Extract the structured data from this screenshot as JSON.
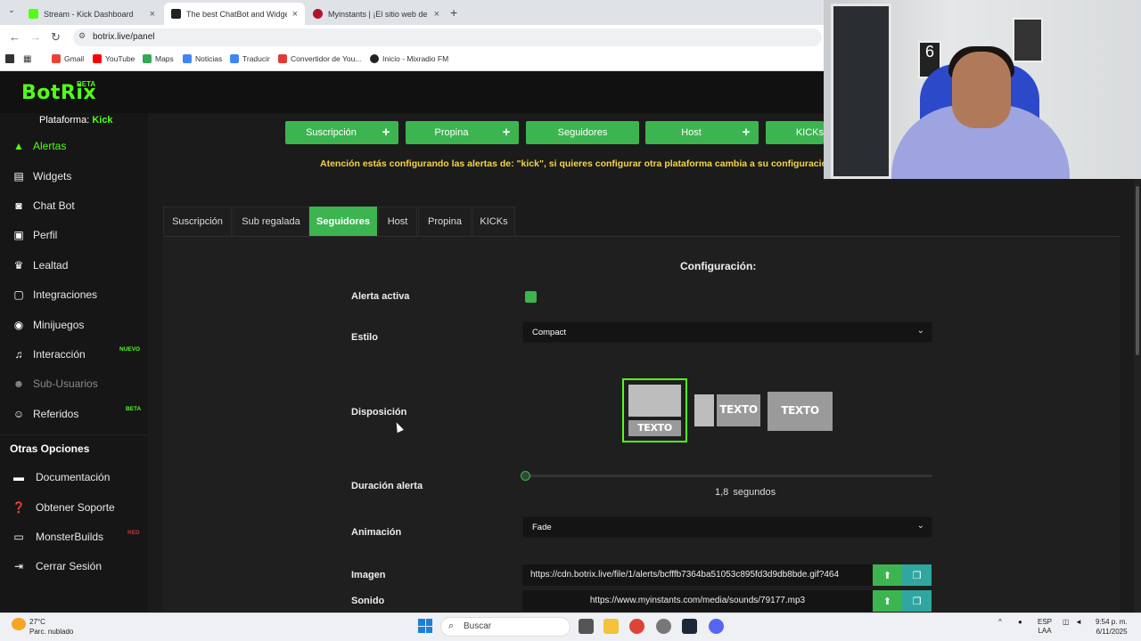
{
  "browser": {
    "tabs": [
      {
        "title": "Stream - Kick Dashboard",
        "color": "#53fc18"
      },
      {
        "title": "The best ChatBot and Widgets",
        "color": "#222222"
      },
      {
        "title": "Myinstants | ¡El sitio web de bo",
        "color": "#b3122e"
      }
    ],
    "url": "botrix.live/panel",
    "bookmarks": [
      "Gmail",
      "YouTube",
      "Maps",
      "Noticias",
      "Traducir",
      "Convertidor de You...",
      "Inicio - Mixradio FM"
    ]
  },
  "app": {
    "logo": "BotRix",
    "logo_badge": "BETA",
    "platform_label": "Plataforma:",
    "platform_value": "Kick",
    "accent_color": "#53fc18",
    "nav": [
      {
        "label": "Alertas",
        "icon": "warning-icon",
        "state": "active"
      },
      {
        "label": "Widgets",
        "icon": "widgets-icon"
      },
      {
        "label": "Chat Bot",
        "icon": "robot-icon"
      },
      {
        "label": "Perfil",
        "icon": "profile-card-icon"
      },
      {
        "label": "Lealtad",
        "icon": "trophy-icon"
      },
      {
        "label": "Integraciones",
        "icon": "integrations-icon"
      },
      {
        "label": "Minijuegos",
        "icon": "gamepad-icon"
      },
      {
        "label": "Interacción",
        "icon": "music-note-icon",
        "badge": "NUEVO"
      },
      {
        "label": "Sub-Usuarios",
        "icon": "user-group-icon",
        "state": "disabled"
      },
      {
        "label": "Referidos",
        "icon": "users-icon",
        "badge": "BETA"
      }
    ],
    "other_title": "Otras Opciones",
    "other": [
      {
        "label": "Documentación",
        "icon": "document-icon"
      },
      {
        "label": "Obtener Soporte",
        "icon": "support-icon"
      },
      {
        "label": "MonsterBuilds",
        "icon": "laptop-icon",
        "badge": "RED"
      },
      {
        "label": "Cerrar Sesión",
        "icon": "logout-icon"
      }
    ]
  },
  "alert_types": [
    {
      "label": "Suscripción",
      "plus": true
    },
    {
      "label": "Propina",
      "plus": true
    },
    {
      "label": "Seguidores",
      "plus": false
    },
    {
      "label": "Host",
      "plus": true
    },
    {
      "label": "KICKs",
      "plus": false
    }
  ],
  "warning": "Atención estás configurando las alertas de: \"kick\", si quieres configurar otra plataforma cambia a su configuració",
  "subtabs": [
    "Suscripción",
    "Sub regalada",
    "Seguidores",
    "Host",
    "Propina",
    "KICKs"
  ],
  "active_subtab": "Seguidores",
  "config": {
    "title": "Configuración:",
    "alerta_activa_label": "Alerta activa",
    "alerta_activa": true,
    "estilo_label": "Estilo",
    "estilo_value": "Compact",
    "disposicion_label": "Disposición",
    "layout_text": "TEXTO",
    "duracion_label": "Duración alerta",
    "duracion_value": "1,8",
    "duracion_unit": "segundos",
    "animacion_label": "Animación",
    "animacion_value": "Fade",
    "imagen_label": "Imagen",
    "imagen_url": "https://cdn.botrix.live/file/1/alerts/bcfffb7364ba51053c895fd3d9db8bde.gif?464",
    "sonido_label": "Sonido",
    "sonido_url": "https://www.myinstants.com/media/sounds/79177.mp3"
  },
  "taskbar": {
    "temp": "27°C",
    "weather": "Parc. nublado",
    "search": "Buscar",
    "lang1": "ESP",
    "lang2": "LAA",
    "time": "9:54 p. m.",
    "date": "6/11/2025"
  }
}
